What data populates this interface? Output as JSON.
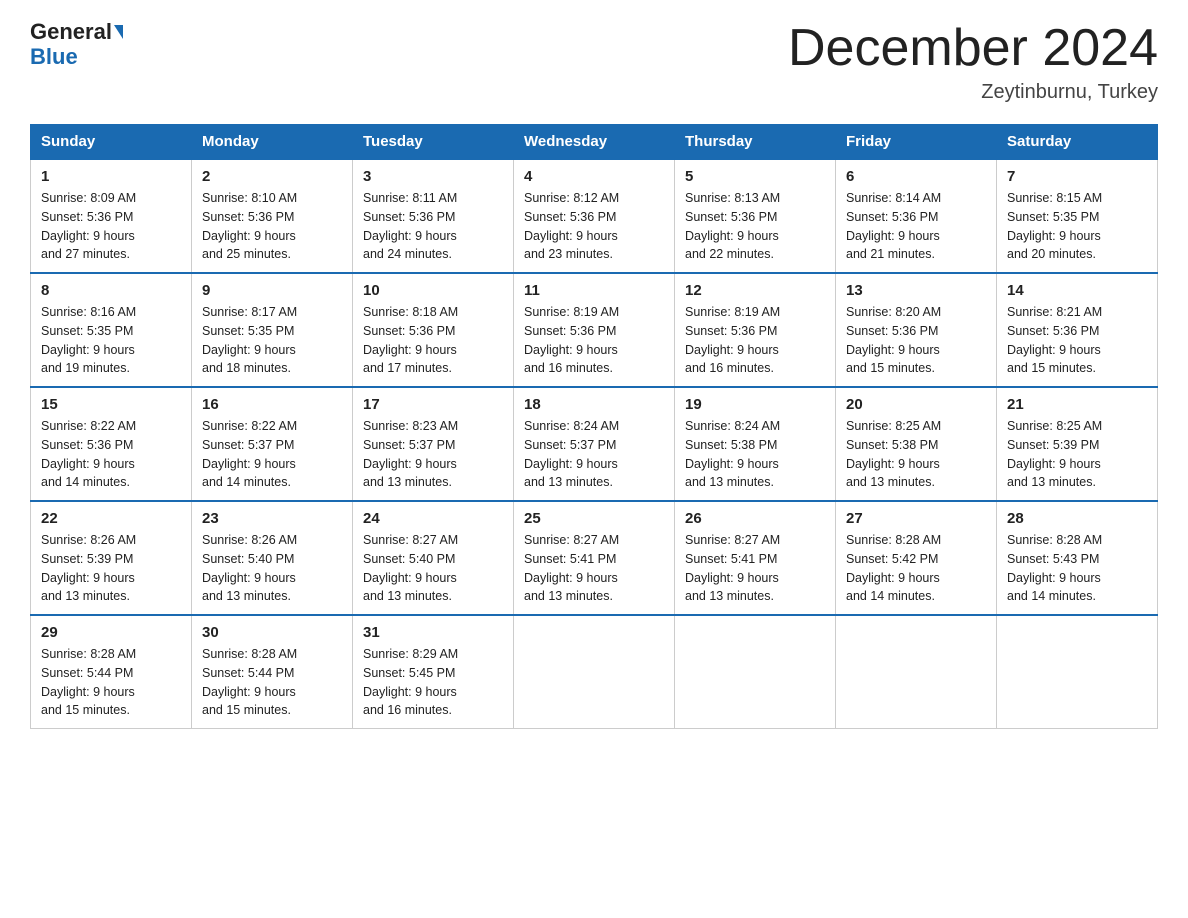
{
  "logo": {
    "general": "General",
    "triangle": "▶",
    "blue": "Blue"
  },
  "header": {
    "month": "December 2024",
    "location": "Zeytinburnu, Turkey"
  },
  "days_of_week": [
    "Sunday",
    "Monday",
    "Tuesday",
    "Wednesday",
    "Thursday",
    "Friday",
    "Saturday"
  ],
  "weeks": [
    [
      {
        "day": "1",
        "sunrise": "8:09 AM",
        "sunset": "5:36 PM",
        "daylight": "9 hours and 27 minutes."
      },
      {
        "day": "2",
        "sunrise": "8:10 AM",
        "sunset": "5:36 PM",
        "daylight": "9 hours and 25 minutes."
      },
      {
        "day": "3",
        "sunrise": "8:11 AM",
        "sunset": "5:36 PM",
        "daylight": "9 hours and 24 minutes."
      },
      {
        "day": "4",
        "sunrise": "8:12 AM",
        "sunset": "5:36 PM",
        "daylight": "9 hours and 23 minutes."
      },
      {
        "day": "5",
        "sunrise": "8:13 AM",
        "sunset": "5:36 PM",
        "daylight": "9 hours and 22 minutes."
      },
      {
        "day": "6",
        "sunrise": "8:14 AM",
        "sunset": "5:36 PM",
        "daylight": "9 hours and 21 minutes."
      },
      {
        "day": "7",
        "sunrise": "8:15 AM",
        "sunset": "5:35 PM",
        "daylight": "9 hours and 20 minutes."
      }
    ],
    [
      {
        "day": "8",
        "sunrise": "8:16 AM",
        "sunset": "5:35 PM",
        "daylight": "9 hours and 19 minutes."
      },
      {
        "day": "9",
        "sunrise": "8:17 AM",
        "sunset": "5:35 PM",
        "daylight": "9 hours and 18 minutes."
      },
      {
        "day": "10",
        "sunrise": "8:18 AM",
        "sunset": "5:36 PM",
        "daylight": "9 hours and 17 minutes."
      },
      {
        "day": "11",
        "sunrise": "8:19 AM",
        "sunset": "5:36 PM",
        "daylight": "9 hours and 16 minutes."
      },
      {
        "day": "12",
        "sunrise": "8:19 AM",
        "sunset": "5:36 PM",
        "daylight": "9 hours and 16 minutes."
      },
      {
        "day": "13",
        "sunrise": "8:20 AM",
        "sunset": "5:36 PM",
        "daylight": "9 hours and 15 minutes."
      },
      {
        "day": "14",
        "sunrise": "8:21 AM",
        "sunset": "5:36 PM",
        "daylight": "9 hours and 15 minutes."
      }
    ],
    [
      {
        "day": "15",
        "sunrise": "8:22 AM",
        "sunset": "5:36 PM",
        "daylight": "9 hours and 14 minutes."
      },
      {
        "day": "16",
        "sunrise": "8:22 AM",
        "sunset": "5:37 PM",
        "daylight": "9 hours and 14 minutes."
      },
      {
        "day": "17",
        "sunrise": "8:23 AM",
        "sunset": "5:37 PM",
        "daylight": "9 hours and 13 minutes."
      },
      {
        "day": "18",
        "sunrise": "8:24 AM",
        "sunset": "5:37 PM",
        "daylight": "9 hours and 13 minutes."
      },
      {
        "day": "19",
        "sunrise": "8:24 AM",
        "sunset": "5:38 PM",
        "daylight": "9 hours and 13 minutes."
      },
      {
        "day": "20",
        "sunrise": "8:25 AM",
        "sunset": "5:38 PM",
        "daylight": "9 hours and 13 minutes."
      },
      {
        "day": "21",
        "sunrise": "8:25 AM",
        "sunset": "5:39 PM",
        "daylight": "9 hours and 13 minutes."
      }
    ],
    [
      {
        "day": "22",
        "sunrise": "8:26 AM",
        "sunset": "5:39 PM",
        "daylight": "9 hours and 13 minutes."
      },
      {
        "day": "23",
        "sunrise": "8:26 AM",
        "sunset": "5:40 PM",
        "daylight": "9 hours and 13 minutes."
      },
      {
        "day": "24",
        "sunrise": "8:27 AM",
        "sunset": "5:40 PM",
        "daylight": "9 hours and 13 minutes."
      },
      {
        "day": "25",
        "sunrise": "8:27 AM",
        "sunset": "5:41 PM",
        "daylight": "9 hours and 13 minutes."
      },
      {
        "day": "26",
        "sunrise": "8:27 AM",
        "sunset": "5:41 PM",
        "daylight": "9 hours and 13 minutes."
      },
      {
        "day": "27",
        "sunrise": "8:28 AM",
        "sunset": "5:42 PM",
        "daylight": "9 hours and 14 minutes."
      },
      {
        "day": "28",
        "sunrise": "8:28 AM",
        "sunset": "5:43 PM",
        "daylight": "9 hours and 14 minutes."
      }
    ],
    [
      {
        "day": "29",
        "sunrise": "8:28 AM",
        "sunset": "5:44 PM",
        "daylight": "9 hours and 15 minutes."
      },
      {
        "day": "30",
        "sunrise": "8:28 AM",
        "sunset": "5:44 PM",
        "daylight": "9 hours and 15 minutes."
      },
      {
        "day": "31",
        "sunrise": "8:29 AM",
        "sunset": "5:45 PM",
        "daylight": "9 hours and 16 minutes."
      },
      null,
      null,
      null,
      null
    ]
  ]
}
